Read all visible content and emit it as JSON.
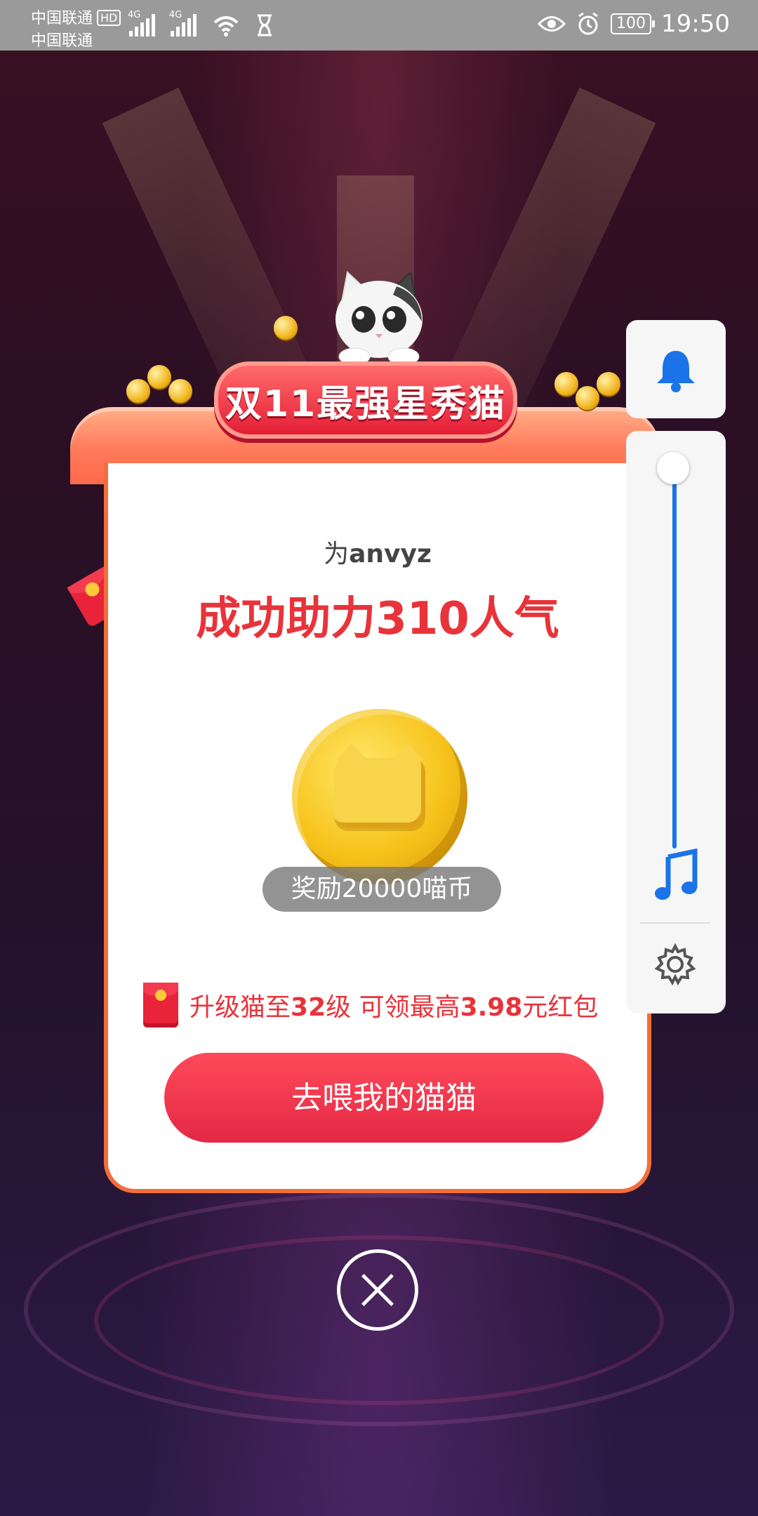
{
  "status_bar": {
    "carrier_primary": "中国联通",
    "carrier_secondary": "中国联通",
    "hd_badge": "HD",
    "network_1": "4G",
    "network_2": "4G",
    "battery": "100",
    "time": "19:50"
  },
  "banner": {
    "title": "双11最强星秀猫"
  },
  "card": {
    "for_prefix": "为",
    "for_name": "anvyz",
    "success_prefix": "成功助力",
    "success_count": "310",
    "success_suffix": "人气",
    "reward_label": "奖励20000喵币",
    "upgrade_prefix": "升级猫至",
    "upgrade_level": "32",
    "upgrade_mid": "级 可领最高",
    "upgrade_amount": "3.98",
    "upgrade_suffix": "元红包",
    "cta_label": "去喂我的猫猫"
  },
  "side_panel": {
    "volume_level": 1.0
  },
  "colors": {
    "accent_red": "#e8333a",
    "cta_red": "#e32844",
    "slider_blue": "#1a73e8"
  }
}
